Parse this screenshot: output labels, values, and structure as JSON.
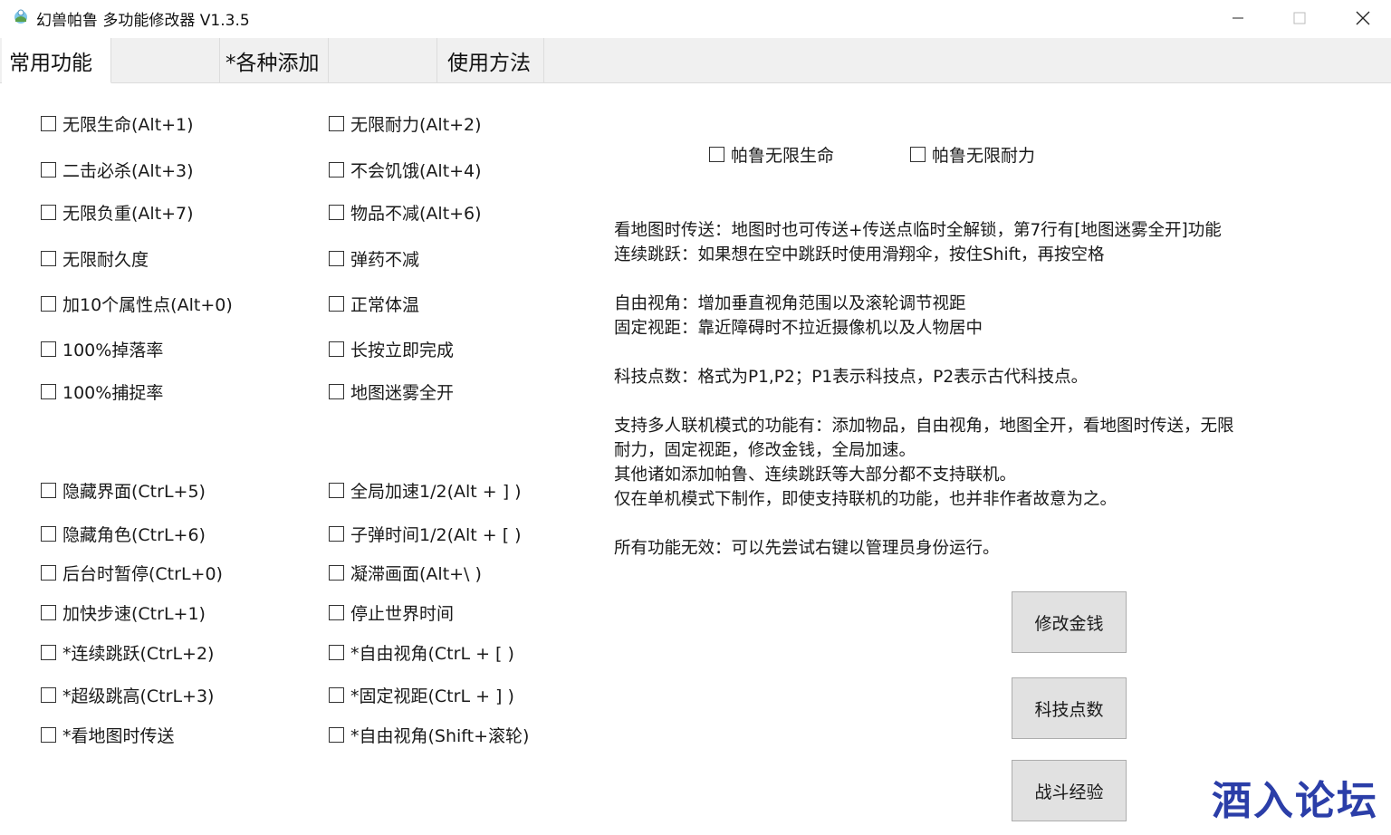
{
  "window": {
    "title": "幻兽帕鲁 多功能修改器  V1.3.5",
    "minimize_icon": "minimize-icon",
    "maximize_icon": "maximize-icon",
    "close_icon": "close-icon"
  },
  "tabs": [
    {
      "label": "常用功能",
      "active": true
    },
    {
      "label": "",
      "active": false
    },
    {
      "label": "*各种添加",
      "active": false
    },
    {
      "label": "",
      "active": false
    },
    {
      "label": "使用方法",
      "active": false
    }
  ],
  "checkboxes": {
    "left_top": [
      "无限生命(Alt+1)",
      "二击必杀(Alt+3)",
      "无限负重(Alt+7)",
      "无限耐久度",
      "加10个属性点(Alt+0)",
      "100%掉落率",
      "100%捕捉率"
    ],
    "right_top": [
      "无限耐力(Alt+2)",
      "不会饥饿(Alt+4)",
      "物品不减(Alt+6)",
      "弹药不减",
      "正常体温",
      "长按立即完成",
      "地图迷雾全开"
    ],
    "left_bottom": [
      "隐藏界面(CtrL+5)",
      "隐藏角色(CtrL+6)",
      "后台时暂停(CtrL+0)",
      "加快步速(CtrL+1)",
      "*连续跳跃(CtrL+2)",
      "*超级跳高(CtrL+3)",
      "*看地图时传送"
    ],
    "right_bottom": [
      "全局加速1/2(Alt + ] )",
      "子弹时间1/2(Alt + [ )",
      "凝滞画面(Alt+\\ )",
      "停止世界时间",
      "*自由视角(CtrL + [ )",
      "*固定视距(CtrL + ] )",
      "*自由视角(Shift+滚轮)"
    ],
    "pal": [
      "帕鲁无限生命",
      "帕鲁无限耐力"
    ]
  },
  "info_lines": [
    "看地图时传送：地图时也可传送+传送点临时全解锁，第7行有[地图迷雾全开]功能",
    "连续跳跃：如果想在空中跳跃时使用滑翔伞，按住Shift，再按空格",
    "自由视角：增加垂直视角范围以及滚轮调节视距",
    "固定视距：靠近障碍时不拉近摄像机以及人物居中",
    "科技点数：格式为P1,P2；P1表示科技点，P2表示古代科技点。",
    "支持多人联机模式的功能有：添加物品，自由视角，地图全开，看地图时传送，无限",
    "耐力，固定视距，修改金钱，全局加速。",
    "其他诸如添加帕鲁、连续跳跃等大部分都不支持联机。",
    "仅在单机模式下制作，即使支持联机的功能，也并非作者故意为之。",
    "所有功能无效：可以先尝试右键以管理员身份运行。"
  ],
  "buttons": {
    "money": "修改金钱",
    "tech": "科技点数",
    "exp": "战斗经验"
  },
  "watermark": "酒入论坛"
}
